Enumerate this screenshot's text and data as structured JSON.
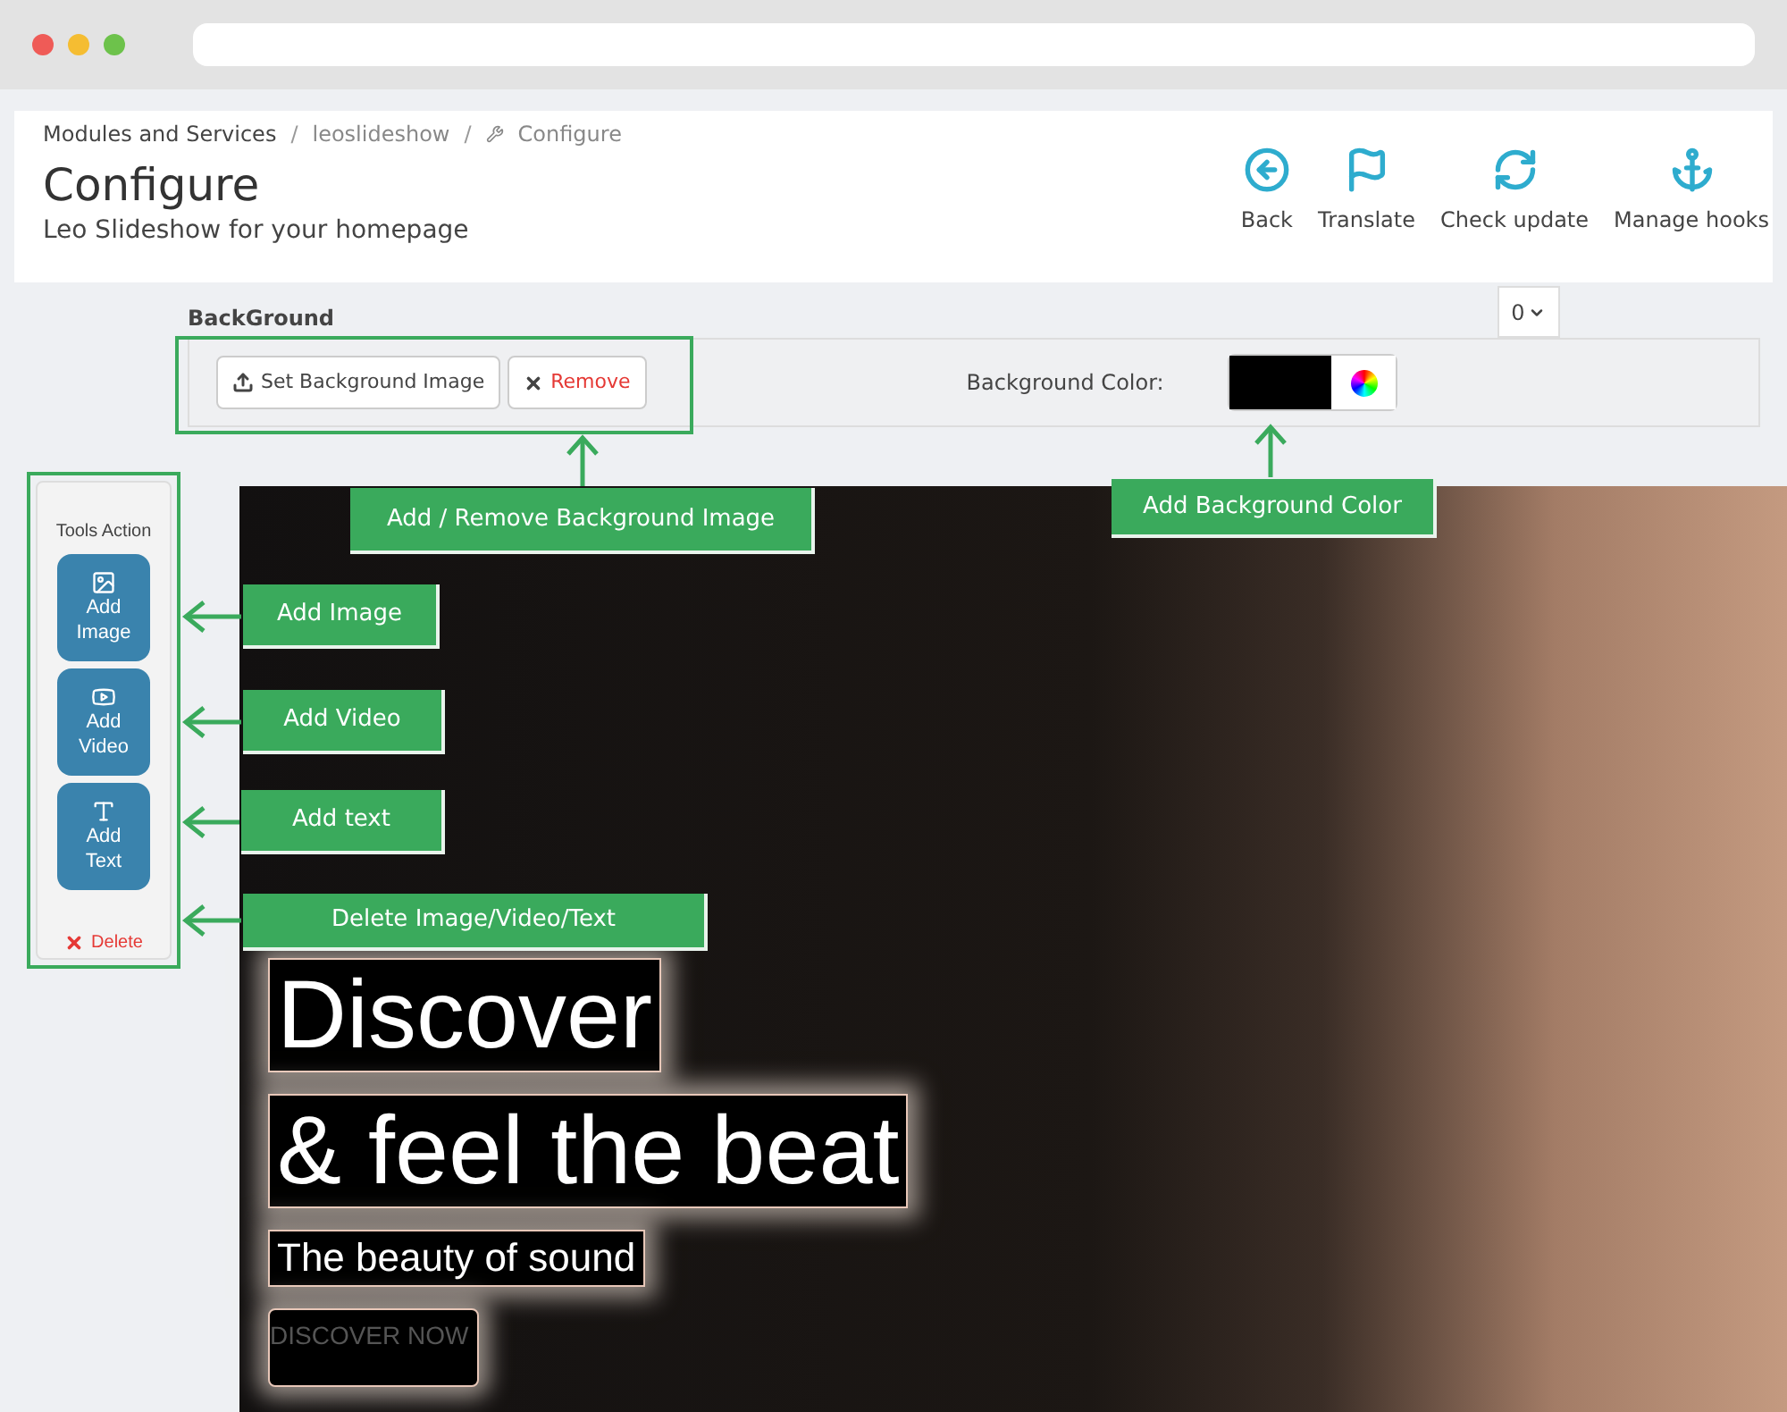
{
  "breadcrumb": [
    "Modules and Services",
    "leoslideshow",
    "Configure"
  ],
  "breadcrumb_separator": "/",
  "page": {
    "title": "Configure",
    "subtitle": "Leo Slideshow for your homepage"
  },
  "toolbar": [
    {
      "label": "Back",
      "kind": "back"
    },
    {
      "label": "Translate",
      "kind": "flag"
    },
    {
      "label": "Check update",
      "kind": "refresh"
    },
    {
      "label": "Manage hooks",
      "kind": "anchor"
    }
  ],
  "background": {
    "title": "BackGround",
    "dropdown": "0",
    "buttons": [
      {
        "label": "Set Background Image",
        "kind": "upload"
      },
      {
        "label": "Remove",
        "kind": "remove"
      }
    ],
    "color_label": "Background Color:",
    "color": "#000000"
  },
  "tools": {
    "title": "Tools Action",
    "items": [
      {
        "label": "Add Image",
        "kind": "image"
      },
      {
        "label": "Add Video",
        "kind": "video"
      },
      {
        "label": "Add Text",
        "kind": "text"
      }
    ],
    "delete": "Delete"
  },
  "slide": {
    "layers": [
      {
        "text": "Discover",
        "kind": "heading"
      },
      {
        "text": "& feel the beat",
        "kind": "heading"
      },
      {
        "text": "The beauty of sound",
        "kind": "subheading"
      },
      {
        "text": "DISCOVER NOW",
        "kind": "button"
      }
    ]
  },
  "callouts": [
    {
      "label": "Add / Remove Background Image",
      "kind": "bg-image"
    },
    {
      "label": "Add Background Color",
      "kind": "bg-color"
    },
    {
      "label": "Add Image",
      "kind": "image"
    },
    {
      "label": "Add Video",
      "kind": "video"
    },
    {
      "label": "Add text",
      "kind": "text"
    },
    {
      "label": "Delete Image/Video/Text",
      "kind": "delete"
    }
  ]
}
